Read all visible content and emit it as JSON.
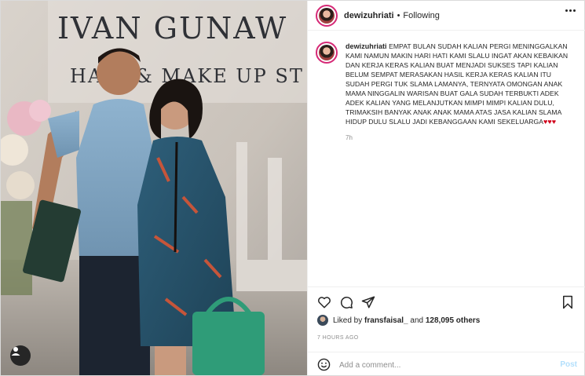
{
  "photo": {
    "sign_line1": "IVAN GUNAW",
    "sign_line2": "HAIR & MAKE UP ST"
  },
  "header": {
    "username": "dewizuhriati",
    "separator": "•",
    "follow_status": "Following"
  },
  "caption": {
    "username": "dewizuhriati",
    "text": "EMPAT BULAN SUDAH KALIAN PERGI MENINGGALKAN KAMI NAMUN MAKIN HARI HATI KAMI SLALU INGAT AKAN KEBAIKAN DAN KERJA KERAS KALIAN BUAT MENJADI SUKSES TAPI KALIAN BELUM SEMPAT MERASAKAN HASIL KERJA KERAS KALIAN ITU SUDAH PERGI TUK SLAMA LAMANYA, TERNYATA OMONGAN ANAK MAMA NINGGALIN WARISAN BUAT GALA SUDAH TERBUKTI ADEK ADEK KALIAN YANG MELANJUTKAN MIMPI MIMPI KALIAN DULU, TRIMAKSIH BANYAK ANAK ANAK MAMA ATAS JASA KALIAN SLAMA HIDUP DULU SLALU JADI KEBANGGAAN KAMI SEKELUARGA",
    "hearts": "♥♥♥",
    "time": "7h"
  },
  "likes": {
    "prefix": "Liked by",
    "user": "fransfaisal_",
    "joiner": "and",
    "others": "128,095 others"
  },
  "posted_ago": "7 HOURS AGO",
  "comment": {
    "placeholder": "Add a comment...",
    "post_label": "Post"
  },
  "colors": {
    "text": "#262626",
    "muted": "#8e8e8e",
    "post_disabled": "#b2dffc",
    "story_ring": "#d62976",
    "heart": "#d0021b"
  },
  "icons": [
    "heart-icon",
    "comment-icon",
    "share-icon",
    "bookmark-icon",
    "emoji-icon",
    "more-icon",
    "tag-user-icon"
  ]
}
